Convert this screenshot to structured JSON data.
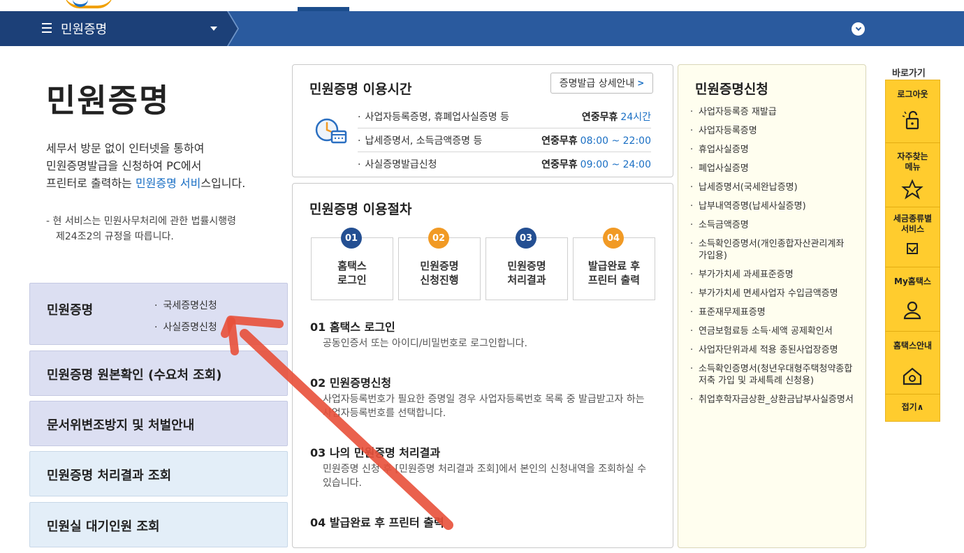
{
  "navbar": {
    "title": "민원증명"
  },
  "intro": {
    "page_title": "민원증명",
    "desc_line1": "세무서 방문 없이 인터넷을 통하여",
    "desc_line2": "민원증명발급을 신청하여 PC에서",
    "desc_line3_pre": "프린터로 출력하는 ",
    "desc_line3_hl": "민원증명 서비",
    "desc_line3_post": "스입니다.",
    "note_line1": "- 현 서비스는 민원사무처리에 관한 법률시행령",
    "note_line2": "제24조2의 규정을 따릅니다."
  },
  "left_menu": {
    "main_label": "민원증명",
    "sub1": "국세증명신청",
    "sub2": "사실증명신청",
    "item2": "민원증명 원본확인 (수요처 조회)",
    "item3": "문서위변조방지 및 처벌안내",
    "item4": "민원증명 처리결과 조회",
    "item5": "민원실 대기인원 조회"
  },
  "hours": {
    "title": "민원증명 이용시간",
    "detail_button": "증명발급 상세안내",
    "rows": [
      {
        "label": "사업자등록증명, 휴폐업사실증명 등",
        "free": "연중무휴",
        "time": "24시간"
      },
      {
        "label": "납세증명서, 소득금액증명 등",
        "free": "연중무휴",
        "time": "08:00 ~ 22:00"
      },
      {
        "label": "사실증명발급신청",
        "free": "연중무휴",
        "time": "09:00 ~ 24:00"
      }
    ]
  },
  "procedure": {
    "title": "민원증명 이용절차",
    "steps": [
      {
        "num": "01",
        "line1": "홈택스",
        "line2": "로그인"
      },
      {
        "num": "02",
        "line1": "민원증명",
        "line2": "신청진행"
      },
      {
        "num": "03",
        "line1": "민원증명",
        "line2": "처리결과"
      },
      {
        "num": "04",
        "line1": "발급완료 후",
        "line2": "프린터 출력"
      }
    ],
    "sections": [
      {
        "head": "01 홈택스 로그인",
        "desc": "공동인증서 또는 아이디/비밀번호로 로그인합니다."
      },
      {
        "head": "02 민원증명신청",
        "desc": "사업자등록번호가 필요한 증명일 경우 사업자등록번호 목록 중 발급받고자 하는 사업자등록번호를 선택합니다."
      },
      {
        "head": "03 나의 민원증명 처리결과",
        "desc": "민원증명 신청 후 [민원증명 처리결과 조회]에서 본인의 신청내역을 조회하실 수 있습니다."
      },
      {
        "head": "04 발급완료 후 프린터 출력",
        "desc": ""
      }
    ]
  },
  "apply": {
    "title": "민원증명신청",
    "items": [
      "사업자등록증 재발급",
      "사업자등록증명",
      "휴업사실증명",
      "폐업사실증명",
      "납세증명서(국세완납증명)",
      "납부내역증명(납세사실증명)",
      "소득금액증명",
      "소득확인증명서(개인종합자산관리계좌 가입용)",
      "부가가치세 과세표준증명",
      "부가가치세 면세사업자 수입금액증명",
      "표준재무제표증명",
      "연금보험료등 소득·세액 공제확인서",
      "사업자단위과세 적용 종된사업장증명",
      "소득확인증명서(청년우대형주택청약종합저축 가입 및 과세특례 신청용)",
      "취업후학자금상환_상환금납부사실증명서"
    ]
  },
  "quick": {
    "title": "바로가기",
    "logout": "로그아웃",
    "faq_line1": "자주찾는",
    "faq_line2": "메뉴",
    "tax_line1": "세금종류별",
    "tax_line2": "서비스",
    "my": "My홈택스",
    "guide": "홈택스안내",
    "fold": "접기∧"
  },
  "colors": {
    "nav": "#2a5a9e",
    "nav_dark": "#1c4078",
    "accent_blue": "#1a6fc4",
    "badge_orange": "#f19a25",
    "quick_yellow": "#ffcc2e",
    "arrow_red": "#e8503a"
  }
}
